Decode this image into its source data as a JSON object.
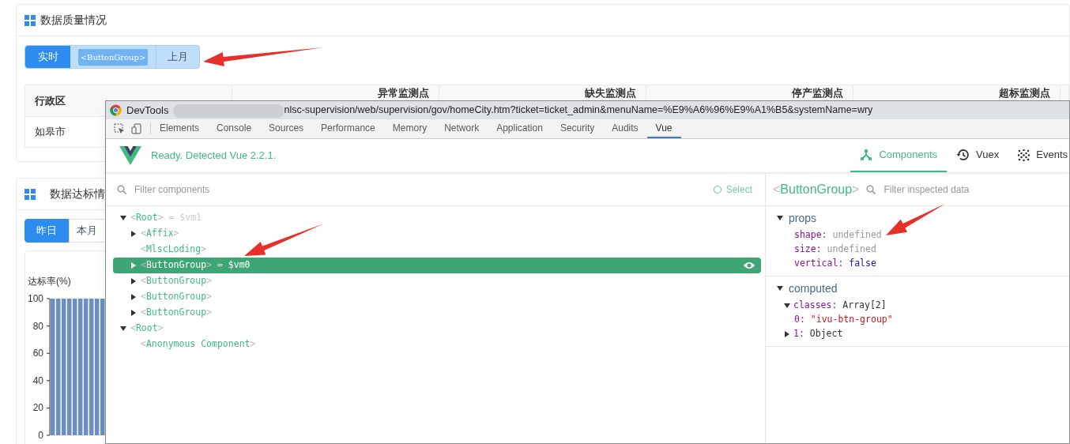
{
  "quality_card": {
    "title": "数据质量情况",
    "period_buttons": [
      {
        "label": "实时",
        "selected": true
      },
      {
        "label": "上月",
        "selected": false
      }
    ],
    "highlight_label": "<ButtonGroup>",
    "table": {
      "columns": [
        "行政区",
        "异常监测点",
        "缺失监测点",
        "停产监测点",
        "超标监测点"
      ],
      "rows": [
        [
          "如皋市"
        ]
      ]
    }
  },
  "compliance_card": {
    "title": "数据达标情",
    "period_buttons": [
      {
        "label": "昨日",
        "selected": true
      },
      {
        "label": "本月",
        "selected": false
      }
    ],
    "chart": {
      "ylabel": "达标率(%)",
      "ytick_labels": [
        "100",
        "80",
        "60",
        "40",
        "20",
        "0"
      ]
    }
  },
  "devtools": {
    "title": "DevTools",
    "url": "nlsc-supervision/web/supervision/gov/homeCity.htm?ticket=ticket_admin&menuName=%E9%A6%96%E9%A1%B5&systemName=wry",
    "tabs": [
      {
        "label": "Elements",
        "selected": false
      },
      {
        "label": "Console",
        "selected": false
      },
      {
        "label": "Sources",
        "selected": false
      },
      {
        "label": "Performance",
        "selected": false
      },
      {
        "label": "Memory",
        "selected": false
      },
      {
        "label": "Network",
        "selected": false
      },
      {
        "label": "Application",
        "selected": false
      },
      {
        "label": "Security",
        "selected": false
      },
      {
        "label": "Audits",
        "selected": false
      },
      {
        "label": "Vue",
        "selected": true
      }
    ],
    "status": "Ready. Detected Vue 2.2.1.",
    "vue_tabs": [
      {
        "label": "Components",
        "kind": "components",
        "selected": true
      },
      {
        "label": "Vuex",
        "kind": "vuex",
        "selected": false
      },
      {
        "label": "Events",
        "kind": "events",
        "selected": false
      }
    ],
    "filter_placeholder": "Filter components",
    "select_button": "Select",
    "tree": [
      {
        "label": "<Root>",
        "suffix": "= $vm1",
        "kind": "branch",
        "expanded": true,
        "selected": false,
        "children": [
          {
            "label": "<Affix>",
            "kind": "branch",
            "expanded": false,
            "selected": false
          },
          {
            "label": "<MlscLoding>",
            "kind": "leaf",
            "selected": false
          },
          {
            "label": "<ButtonGroup>",
            "suffix": "= $vm0",
            "kind": "branch",
            "expanded": false,
            "selected": true
          },
          {
            "label": "<ButtonGroup>",
            "kind": "branch",
            "expanded": false,
            "selected": false
          },
          {
            "label": "<ButtonGroup>",
            "kind": "branch",
            "expanded": false,
            "selected": false
          },
          {
            "label": "<ButtonGroup>",
            "kind": "branch",
            "expanded": false,
            "selected": false
          }
        ]
      },
      {
        "label": "<Root>",
        "kind": "branch",
        "expanded": true,
        "selected": false,
        "children": [
          {
            "label": "<Anonymous Component>",
            "kind": "leaf",
            "selected": false
          }
        ]
      }
    ],
    "inspector": {
      "title": "<ButtonGroup>",
      "filter_placeholder": "Filter inspected data",
      "sections": [
        {
          "title": "props",
          "expanded": true,
          "entries": [
            {
              "key": "shape:",
              "value": "undefined",
              "kind": "undefined"
            },
            {
              "key": "size:",
              "value": "undefined",
              "kind": "undefined"
            },
            {
              "key": "vertical:",
              "value": "false",
              "kind": "boolean"
            }
          ]
        },
        {
          "title": "computed",
          "expanded": true,
          "entries": [
            {
              "key": "classes:",
              "value": "Array[2]",
              "kind": "object",
              "expanded": true,
              "children": [
                {
                  "key": "0:",
                  "value": "\"ivu-btn-group\"",
                  "kind": "string"
                },
                {
                  "key": "1:",
                  "value": "Object",
                  "kind": "object",
                  "expanded": false
                }
              ]
            }
          ]
        }
      ]
    }
  }
}
